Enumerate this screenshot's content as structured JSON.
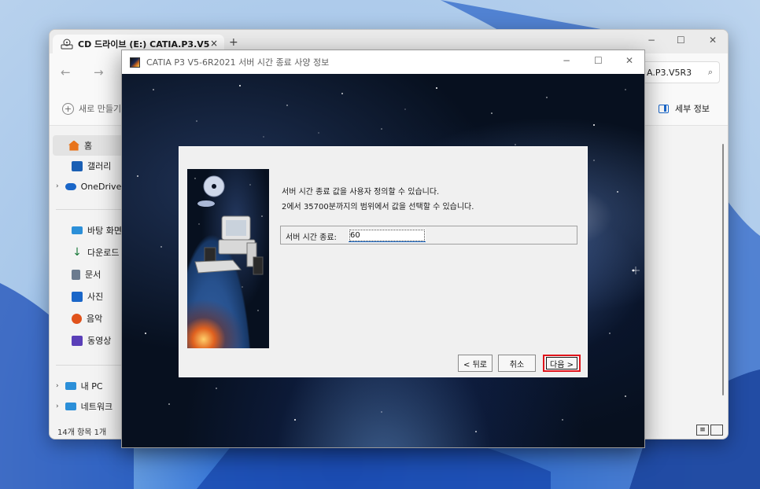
{
  "explorer": {
    "tab_title": "CD 드라이브 (E:) CATIA.P3.V5",
    "tab_close": "×",
    "new_tab": "+",
    "window_controls": {
      "minimize": "−",
      "maximize": "☐",
      "close": "✕"
    },
    "nav": {
      "back": "←",
      "forward": "→"
    },
    "search_value": "A.P3.V5R3",
    "new_button": "새로 만들기",
    "details_label": "세부 정보",
    "sidebar": [
      {
        "label": "홈",
        "icon": "home-icon",
        "color": "#e8731a"
      },
      {
        "label": "갤러리",
        "icon": "gallery-icon",
        "color": "#1a5fb4"
      },
      {
        "label": "OneDrive",
        "icon": "cloud-icon",
        "color": "#1a66c8"
      },
      {
        "label": "바탕 화면",
        "icon": "desktop-icon",
        "color": "#2b8fd8"
      },
      {
        "label": "다운로드",
        "icon": "download-icon",
        "color": "#1a7a3a"
      },
      {
        "label": "문서",
        "icon": "document-icon",
        "color": "#6b7b8f"
      },
      {
        "label": "사진",
        "icon": "photo-icon",
        "color": "#1a66c8"
      },
      {
        "label": "음악",
        "icon": "music-icon",
        "color": "#e0521b"
      },
      {
        "label": "동영상",
        "icon": "video-icon",
        "color": "#5a3fb8"
      },
      {
        "label": "내 PC",
        "icon": "pc-icon",
        "color": "#2b8fd8"
      },
      {
        "label": "네트워크",
        "icon": "network-icon",
        "color": "#2b8fd8"
      }
    ],
    "status": "14개 항목   1개"
  },
  "catia": {
    "title": "CATIA P3 V5-6R2021 서버 시간 종료 사양 정보",
    "window_controls": {
      "minimize": "−",
      "maximize": "☐",
      "close": "✕"
    },
    "message_line1": "서버 시간 종료 값을 사용자 정의할 수 있습니다.",
    "message_line2": "2에서 35700분까지의 범위에서 값을 선택할 수 있습니다.",
    "field_label": "서버 시간 종료:",
    "field_value": "60",
    "buttons": {
      "back": "< 뒤로",
      "cancel": "취소",
      "next": "다음 >"
    },
    "highlight_color": "#e0141b"
  }
}
